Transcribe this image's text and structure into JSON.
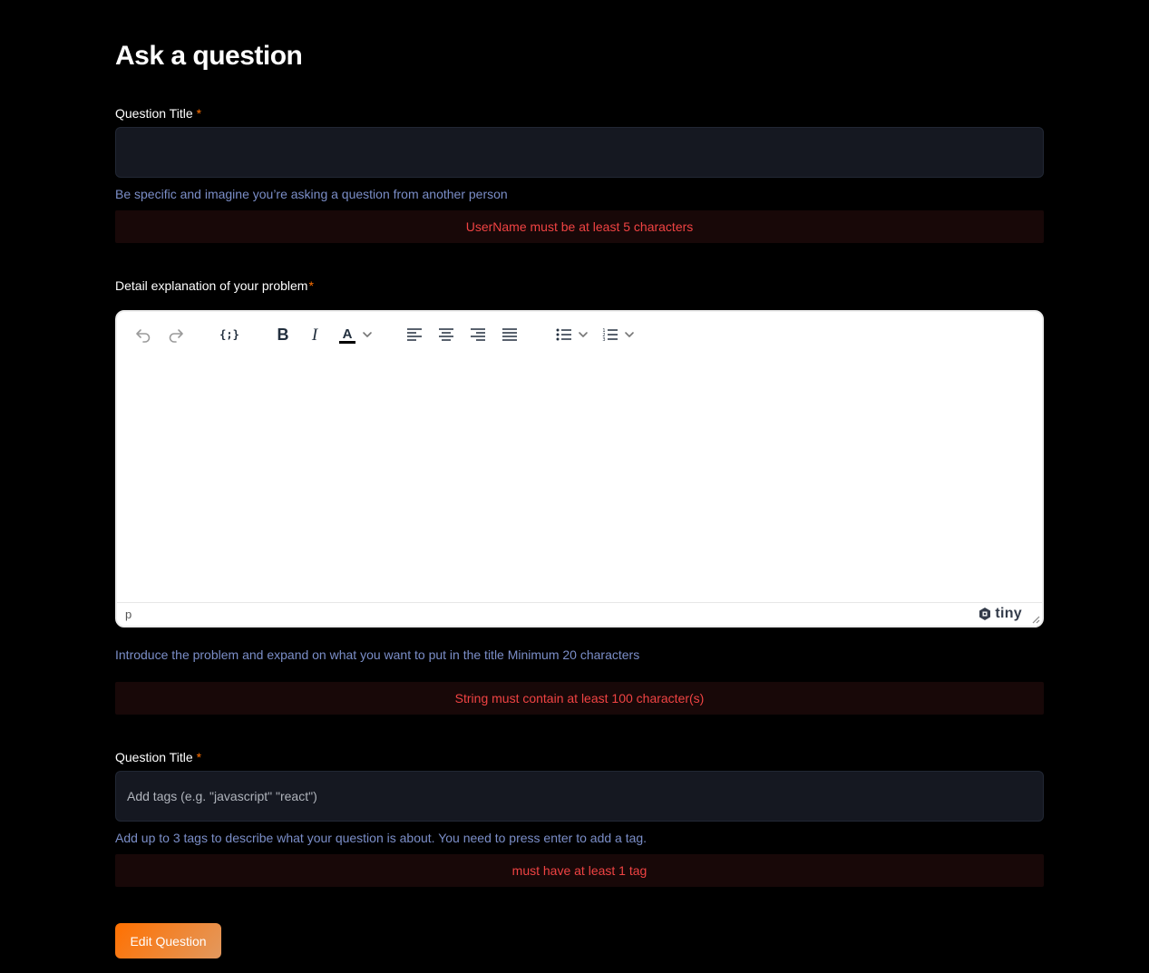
{
  "page": {
    "title": "Ask a question"
  },
  "title_field": {
    "label": "Question Title",
    "required_mark": "*",
    "value": "",
    "placeholder": "",
    "hint": "Be specific and imagine you’re asking a question from another person",
    "error": "UserName must be at least 5 characters"
  },
  "explanation_field": {
    "label": "Detail explanation of your problem",
    "required_mark": "*",
    "toolbar": [
      {
        "name": "undo-icon"
      },
      {
        "name": "redo-icon"
      },
      {
        "name": "code-sample-icon"
      },
      {
        "name": "bold-icon"
      },
      {
        "name": "italic-icon"
      },
      {
        "name": "text-color-icon"
      },
      {
        "name": "align-left-icon"
      },
      {
        "name": "align-center-icon"
      },
      {
        "name": "align-right-icon"
      },
      {
        "name": "align-justify-icon"
      },
      {
        "name": "bullet-list-icon"
      },
      {
        "name": "numbered-list-icon"
      }
    ],
    "status_path": "p",
    "brand": "tiny",
    "hint": "Introduce the problem and expand on what you want to put in the title Minimum 20 characters",
    "error": "String must contain at least 100 character(s)"
  },
  "tags_field": {
    "label": "Question Title",
    "required_mark": "*",
    "value": "",
    "placeholder": "Add tags (e.g. \"javascript\" \"react\")",
    "hint": "Add up to 3 tags to describe what your question is about. You need to press enter to add a tag.",
    "error": "must have at least 1 tag"
  },
  "submit": {
    "label": "Edit Question"
  },
  "colors": {
    "background": "#000000",
    "accent": "#ff7000",
    "input_bg": "#151821",
    "hint": "#7b8ec8",
    "error_text": "#f04343",
    "error_bg": "#180808"
  }
}
